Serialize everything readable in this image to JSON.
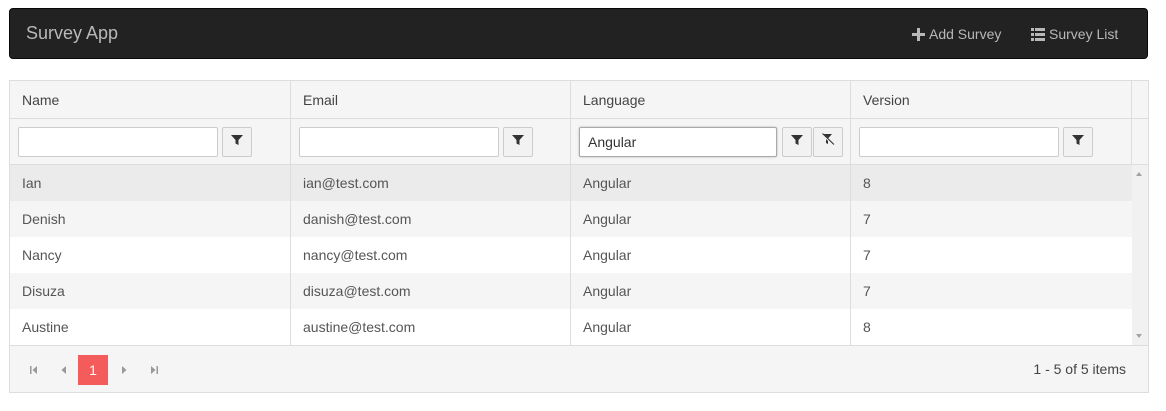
{
  "navbar": {
    "brand": "Survey App",
    "add_label": "Add Survey",
    "list_label": "Survey List",
    "add_icon": "plus-icon",
    "list_icon": "list-icon"
  },
  "grid": {
    "columns": [
      "Name",
      "Email",
      "Language",
      "Version"
    ],
    "filters": {
      "name": "",
      "email": "",
      "language": "Angular",
      "version": ""
    },
    "rows": [
      {
        "name": "Ian",
        "email": "ian@test.com",
        "language": "Angular",
        "version": "8"
      },
      {
        "name": "Denish",
        "email": "danish@test.com",
        "language": "Angular",
        "version": "7"
      },
      {
        "name": "Nancy",
        "email": "nancy@test.com",
        "language": "Angular",
        "version": "7"
      },
      {
        "name": "Disuza",
        "email": "disuza@test.com",
        "language": "Angular",
        "version": "7"
      },
      {
        "name": "Austine",
        "email": "austine@test.com",
        "language": "Angular",
        "version": "8"
      }
    ]
  },
  "pager": {
    "current_page": "1",
    "info": "1 - 5 of 5 items"
  },
  "colors": {
    "navbar_bg": "#222222",
    "active_page": "#f35c5a"
  }
}
